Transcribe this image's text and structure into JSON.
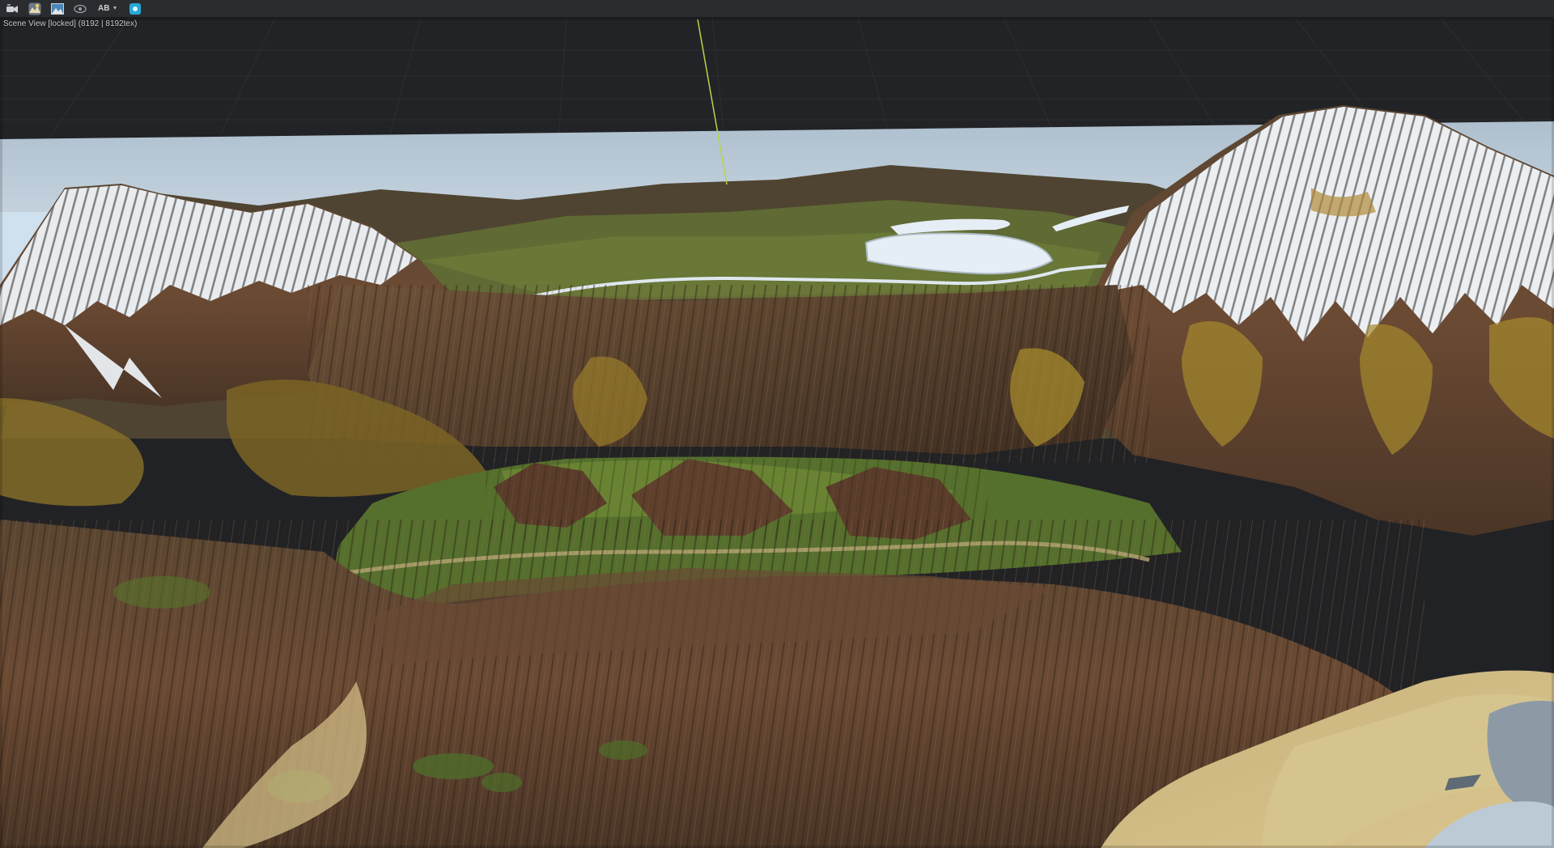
{
  "toolbar": {
    "items": [
      {
        "name": "camera-icon"
      },
      {
        "name": "terrain-preview-icon"
      },
      {
        "name": "image-icon"
      },
      {
        "name": "eye-icon"
      },
      {
        "name": "ab-compare-dropdown",
        "label": "AB"
      },
      {
        "name": "sphere-icon"
      }
    ],
    "ab_label": "AB"
  },
  "viewport": {
    "label": "Scene View [locked] (8192 | 8192tex)"
  },
  "colors": {
    "toolbar_bg": "#2b2c2f",
    "viewport_bg": "#212225",
    "accent": "#27a7d8",
    "axis_line": "#b7d44a"
  }
}
